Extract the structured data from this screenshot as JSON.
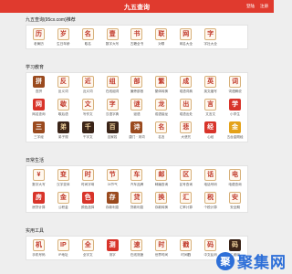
{
  "header": {
    "title": "九五查询",
    "link_login": "登陆",
    "link_register": "注册"
  },
  "sec_recommend": {
    "title": "九五查询(95cx.com)推荐",
    "items": [
      {
        "label": "老黄历",
        "icon": "历",
        "style": "outline"
      },
      {
        "label": "生日年龄",
        "icon": "岁",
        "style": "outline"
      },
      {
        "label": "取名",
        "icon": "名",
        "style": "outline"
      },
      {
        "label": "数字大写",
        "icon": "壹",
        "style": "outline"
      },
      {
        "label": "古籍全书",
        "icon": "书",
        "style": "outline"
      },
      {
        "label": "对联",
        "icon": "联",
        "style": "outline"
      },
      {
        "label": "网名大全",
        "icon": "网",
        "style": "outline"
      },
      {
        "label": "字社大全",
        "icon": "字",
        "style": "outline"
      }
    ]
  },
  "sec_study": {
    "title": "学习教育",
    "items": [
      {
        "label": "查拼",
        "icon": "拼",
        "style": "solid-brown"
      },
      {
        "label": "反义词",
        "icon": "反",
        "style": "outline"
      },
      {
        "label": "近义词",
        "icon": "近",
        "style": "outline"
      },
      {
        "label": "在线组词",
        "icon": "组",
        "style": "outline"
      },
      {
        "label": "偏旁部首",
        "icon": "部",
        "style": "outline"
      },
      {
        "label": "繁体转换",
        "icon": "繁",
        "style": "outline"
      },
      {
        "label": "成语词典",
        "icon": "成",
        "style": "outline"
      },
      {
        "label": "英文缩写",
        "icon": "英",
        "style": "outline"
      },
      {
        "label": "词语解说",
        "icon": "词",
        "style": "outline"
      },
      {
        "label": "网名查询",
        "icon": "网",
        "style": "solid-red"
      },
      {
        "label": "歇后语",
        "icon": "歇",
        "style": "outline"
      },
      {
        "label": "写作文",
        "icon": "文",
        "style": "outline"
      },
      {
        "label": "汉语字典",
        "icon": "字",
        "style": "outline"
      },
      {
        "label": "谜语",
        "icon": "谜",
        "style": "outline"
      },
      {
        "label": "成语接龙",
        "icon": "龙",
        "style": "outline"
      },
      {
        "label": "成语出处",
        "icon": "出",
        "style": "outline"
      },
      {
        "label": "文言文",
        "icon": "言",
        "style": "outline"
      },
      {
        "label": "小学生",
        "icon": "学",
        "style": "solid-red"
      },
      {
        "label": "三字经",
        "icon": "三",
        "style": "solid-brown"
      },
      {
        "label": "弟子规",
        "icon": "弟",
        "style": "solid-dark"
      },
      {
        "label": "千字文",
        "icon": "千",
        "style": "solid-dark"
      },
      {
        "label": "百家姓",
        "icon": "百",
        "style": "solid-dark"
      },
      {
        "label": "唐门 · 宋词",
        "icon": "诗",
        "style": "solid-brown"
      },
      {
        "label": "名言",
        "icon": "名",
        "style": "outline"
      },
      {
        "label": "大悲咒",
        "icon": "悲",
        "style": "outline"
      },
      {
        "label": "心经",
        "icon": "经",
        "style": "solid-red"
      },
      {
        "label": "五台金刚经",
        "icon": "金",
        "style": "solid-gold"
      }
    ]
  },
  "sec_life": {
    "title": "日常生活",
    "items": [
      {
        "label": "数字大写",
        "icon": "¥",
        "style": "outline"
      },
      {
        "label": "汉字变体",
        "icon": "变",
        "style": "outline"
      },
      {
        "label": "时间字母",
        "icon": "时",
        "style": "outline"
      },
      {
        "label": "24节气",
        "icon": "节",
        "style": "outline"
      },
      {
        "label": "汽车品牌",
        "icon": "车",
        "style": "outline"
      },
      {
        "label": "邮编查询",
        "icon": "邮",
        "style": "outline"
      },
      {
        "label": "区号查询",
        "icon": "区",
        "style": "outline"
      },
      {
        "label": "电话号码",
        "icon": "话",
        "style": "outline"
      },
      {
        "label": "电费查询",
        "icon": "电",
        "style": "outline"
      },
      {
        "label": "房贷计算",
        "icon": "房",
        "style": "solid-red"
      },
      {
        "label": "公积金",
        "icon": "金",
        "style": "outline"
      },
      {
        "label": "颜色选择",
        "icon": "色",
        "style": "solid-red"
      },
      {
        "label": "存款利息",
        "icon": "存",
        "style": "solid-brown"
      },
      {
        "label": "贷款利息",
        "icon": "贷",
        "style": "outline"
      },
      {
        "label": "存款转换",
        "icon": "换",
        "style": "outline"
      },
      {
        "label": "汇率计算",
        "icon": "汇",
        "style": "outline"
      },
      {
        "label": "个税计算",
        "icon": "税",
        "style": "outline"
      },
      {
        "label": "安全期",
        "icon": "安",
        "style": "outline"
      }
    ]
  },
  "sec_tools": {
    "title": "实用工具",
    "items": [
      {
        "label": "手机号码",
        "icon": "机",
        "style": "outline"
      },
      {
        "label": "IP地址",
        "icon": "IP",
        "style": "outline"
      },
      {
        "label": "全字文",
        "icon": "全",
        "style": "outline"
      },
      {
        "label": "测字",
        "icon": "测",
        "style": "solid-red"
      },
      {
        "label": "在线测速",
        "icon": "速",
        "style": "outline"
      },
      {
        "label": "世界时间",
        "icon": "时",
        "style": "outline"
      },
      {
        "label": "时间戳",
        "icon": "戳",
        "style": "outline"
      },
      {
        "label": "中文乱码",
        "icon": "码",
        "style": "outline"
      },
      {
        "label": "二维码",
        "icon": "码",
        "style": "solid-dark"
      }
    ]
  },
  "watermark": {
    "text": "聚集网",
    "badge": "聚"
  }
}
